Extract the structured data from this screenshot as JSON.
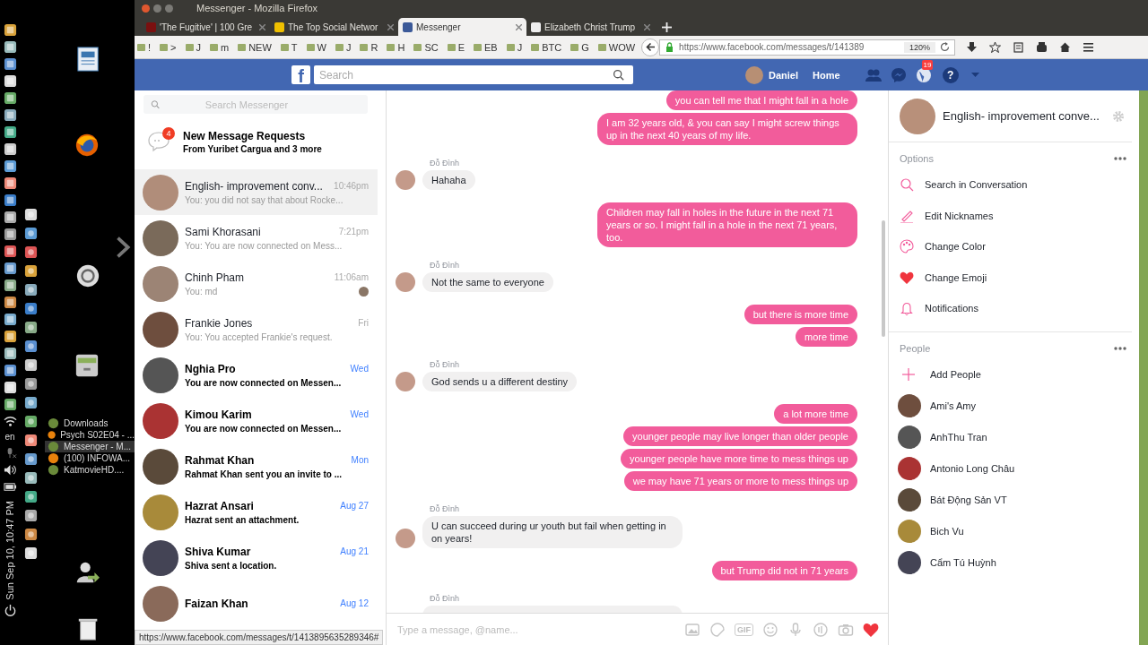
{
  "desktop": {
    "window_list": [
      {
        "label": "Downloads",
        "selected": false
      },
      {
        "label": "Psych S02E04 - ...",
        "selected": false
      },
      {
        "label": "Messenger - M...",
        "selected": true
      },
      {
        "label": "(100) INFOWA...",
        "selected": false
      },
      {
        "label": "KatmovieHD....",
        "selected": false
      }
    ],
    "keyboard_layout": "en",
    "clock": "Sun Sep 10, 10:47 PM"
  },
  "window": {
    "title": "Messenger - Mozilla Firefox"
  },
  "tabs": [
    {
      "label": "'The Fugitive' | 100 Gre",
      "selected": false
    },
    {
      "label": "The Top Social Networ",
      "selected": false
    },
    {
      "label": "Messenger",
      "selected": true
    },
    {
      "label": "Elizabeth Christ Trump",
      "selected": false
    }
  ],
  "bookmarks": [
    "!",
    ">",
    "J",
    "m",
    "NEW",
    "T",
    "W",
    "J",
    "R",
    "H",
    "SC",
    "E",
    "EB",
    "J",
    "BTC",
    "G",
    "WOW"
  ],
  "address_bar": {
    "url": "https://www.facebook.com/messages/t/141389",
    "zoom": "120%"
  },
  "facebook_bar": {
    "logo": "f",
    "search_placeholder": "Search",
    "user": "Daniel",
    "home": "Home",
    "notifications_badge": "19",
    "help": "?"
  },
  "conversations": {
    "search_placeholder": "Search Messenger",
    "requests": {
      "badge": "4",
      "title": "New Message Requests",
      "subtitle": "From Yuribet Cargua and 3 more"
    },
    "items": [
      {
        "name": "English- improvement conv...",
        "snippet": "You: you did not say that about Rocke...",
        "time": "10:46pm",
        "unread": false,
        "selected": true,
        "seen": false
      },
      {
        "name": "Sami Khorasani",
        "snippet": "You: You are now connected on Mess...",
        "time": "7:21pm",
        "unread": false,
        "selected": false,
        "seen": false
      },
      {
        "name": "Chinh Pham",
        "snippet": "You: md",
        "time": "11:06am",
        "unread": false,
        "selected": false,
        "seen": true
      },
      {
        "name": "Frankie Jones",
        "snippet": "You: You accepted Frankie's request.",
        "time": "Fri",
        "unread": false,
        "selected": false,
        "seen": false
      },
      {
        "name": "Nghia Pro",
        "snippet": "You are now connected on Messen...",
        "time": "Wed",
        "unread": true,
        "selected": false,
        "seen": false
      },
      {
        "name": "Kimou Karim",
        "snippet": "You are now connected on Messen...",
        "time": "Wed",
        "unread": true,
        "selected": false,
        "seen": false
      },
      {
        "name": "Rahmat Khan",
        "snippet": "Rahmat Khan sent you an invite to ...",
        "time": "Mon",
        "unread": true,
        "selected": false,
        "seen": false
      },
      {
        "name": "Hazrat Ansari",
        "snippet": "Hazrat sent an attachment.",
        "time": "Aug 27",
        "unread": true,
        "selected": false,
        "seen": false
      },
      {
        "name": "Shiva Kumar",
        "snippet": "Shiva sent a location.",
        "time": "Aug 21",
        "unread": true,
        "selected": false,
        "seen": false
      },
      {
        "name": "Faizan Khan",
        "time": "Aug 12",
        "unread": true,
        "selected": false,
        "seen": false
      }
    ]
  },
  "chat": {
    "groups": [
      {
        "kind": "out",
        "lines": [
          "you can tell me that I might fall in a hole",
          "I am 32 years old, & you can say I might screw things up in the next 40 years of my life."
        ]
      },
      {
        "kind": "in",
        "sender": "Đỗ Đình",
        "lines": [
          "Hahaha"
        ]
      },
      {
        "kind": "out",
        "lines": [
          "Children may fall in holes in the future in the next 71 years or so. I might fall in a hole in the next 71 years, too."
        ]
      },
      {
        "kind": "in",
        "sender": "Đỗ Đình",
        "lines": [
          "Not the same to everyone"
        ]
      },
      {
        "kind": "out",
        "lines": [
          "but there is more time",
          "more time"
        ]
      },
      {
        "kind": "in",
        "sender": "Đỗ Đình",
        "lines": [
          "God sends u a different destiny"
        ]
      },
      {
        "kind": "out",
        "lines": [
          "a lot more time",
          "younger people may live longer than older people",
          "younger people have more time to mess things up",
          "we may have 71 years or more to mess things up"
        ]
      },
      {
        "kind": "in",
        "sender": "Đỗ Đình",
        "lines": [
          "U can succeed during ur youth but fail when getting in on years!"
        ]
      },
      {
        "kind": "out",
        "lines": [
          "but Trump did not in 71 years"
        ]
      },
      {
        "kind": "in",
        "sender": "Đỗ Đình"
      }
    ],
    "composer": {
      "placeholder": "Type a message, @name...",
      "gif_label": "GIF"
    }
  },
  "details": {
    "title": "English- improvement conve...",
    "options_heading": "Options",
    "options": [
      {
        "kind": "search",
        "label": "Search in Conversation"
      },
      {
        "kind": "nickname",
        "label": "Edit Nicknames"
      },
      {
        "kind": "color",
        "label": "Change Color"
      },
      {
        "kind": "emoji",
        "label": "Change Emoji"
      },
      {
        "kind": "notifications",
        "label": "Notifications"
      }
    ],
    "people_heading": "People",
    "add_people": "Add People",
    "people": [
      "Ami's Amy",
      "AnhThu Tran",
      "Antonio Long Châu",
      "Bát Động Sản VT",
      "Bich Vu",
      "Cẩm Tú Huỳnh"
    ]
  },
  "status_url": "https://www.facebook.com/messages/t/1413895635289346#"
}
